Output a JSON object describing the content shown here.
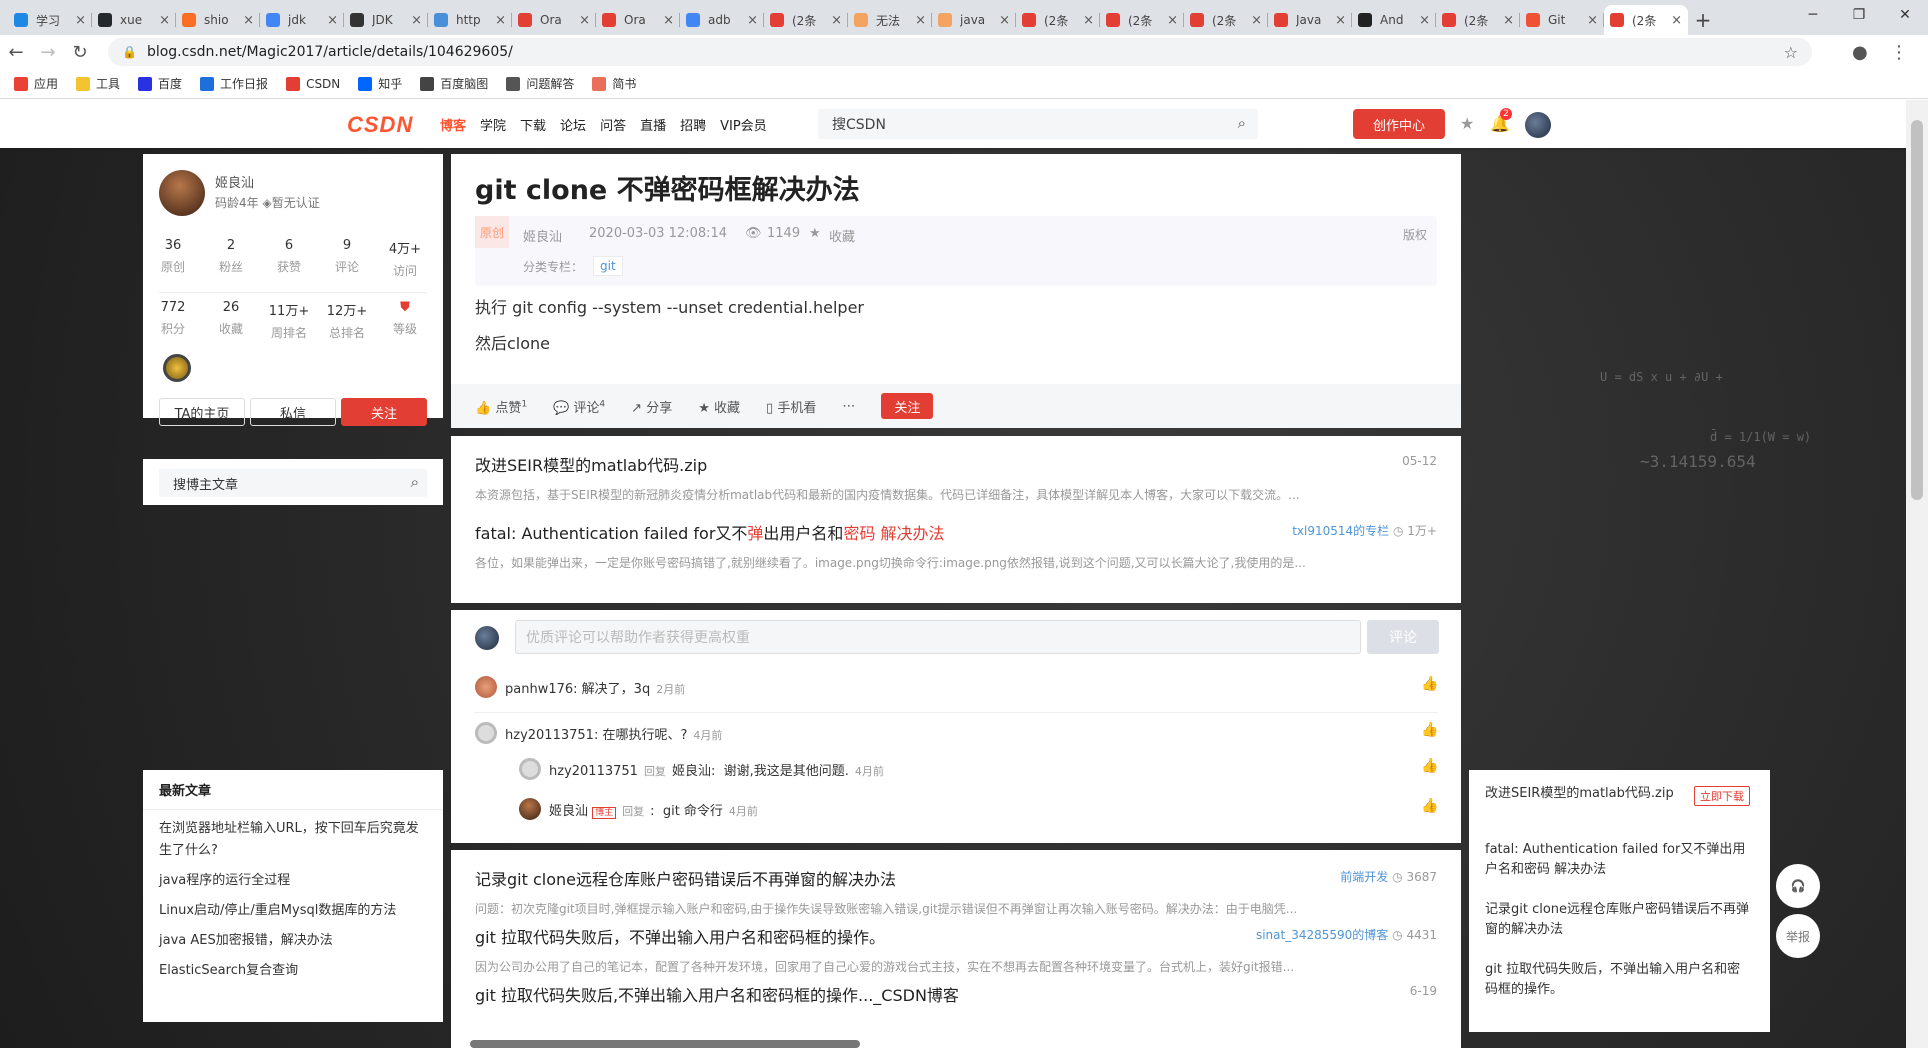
{
  "browser": {
    "tabs": [
      {
        "label": "学习",
        "color": "#1e88e5"
      },
      {
        "label": "xue",
        "color": "#24292e"
      },
      {
        "label": "shio",
        "color": "#fc6d26"
      },
      {
        "label": "jdk",
        "color": "#4285f4"
      },
      {
        "label": "JDK",
        "color": "#333"
      },
      {
        "label": "http",
        "color": "#4a90d9"
      },
      {
        "label": "Ora",
        "color": "#e33e33"
      },
      {
        "label": "Ora",
        "color": "#e33e33"
      },
      {
        "label": "adb",
        "color": "#4285f4"
      },
      {
        "label": "(2条",
        "color": "#e33e33"
      },
      {
        "label": "无法",
        "color": "#f4a460"
      },
      {
        "label": "java",
        "color": "#f4a460"
      },
      {
        "label": "(2条",
        "color": "#e33e33"
      },
      {
        "label": "(2条",
        "color": "#e33e33"
      },
      {
        "label": "(2条",
        "color": "#e33e33"
      },
      {
        "label": "Java",
        "color": "#e33e33"
      },
      {
        "label": "And",
        "color": "#222"
      },
      {
        "label": "(2条",
        "color": "#e33e33"
      },
      {
        "label": "Git",
        "color": "#f05033"
      },
      {
        "label": "(2条",
        "color": "#e33e33"
      }
    ],
    "url": "blog.csdn.net/Magic2017/article/details/104629605/",
    "bookmarks": [
      {
        "label": "应用",
        "color": "#ea4335"
      },
      {
        "label": "工具",
        "color": "#f4c430"
      },
      {
        "label": "百度",
        "color": "#2932e1"
      },
      {
        "label": "工作日报",
        "color": "#1e6fd9"
      },
      {
        "label": "CSDN",
        "color": "#e33e33"
      },
      {
        "label": "知乎",
        "color": "#0066ff"
      },
      {
        "label": "百度脑图",
        "color": "#444"
      },
      {
        "label": "问题解答",
        "color": "#555"
      },
      {
        "label": "简书",
        "color": "#ea6f5a"
      }
    ]
  },
  "nav": {
    "logo": "CSDN",
    "links": [
      "博客",
      "学院",
      "下载",
      "论坛",
      "问答",
      "直播",
      "招聘",
      "VIP会员"
    ],
    "search_placeholder": "搜CSDN",
    "create": "创作中心",
    "badge": "2"
  },
  "profile": {
    "name": "姬良汕",
    "age": "码龄4年",
    "cert": "暂无认证",
    "stats1": [
      {
        "n": "36",
        "l": "原创"
      },
      {
        "n": "2",
        "l": "粉丝"
      },
      {
        "n": "6",
        "l": "获赞"
      },
      {
        "n": "9",
        "l": "评论"
      },
      {
        "n": "4万+",
        "l": "访问"
      }
    ],
    "stats2": [
      {
        "n": "772",
        "l": "积分"
      },
      {
        "n": "26",
        "l": "收藏"
      },
      {
        "n": "11万+",
        "l": "周排名"
      },
      {
        "n": "12万+",
        "l": "总排名"
      },
      {
        "n": "",
        "l": "等级"
      }
    ],
    "btn_home": "TA的主页",
    "btn_msg": "私信",
    "btn_follow": "关注"
  },
  "blog_search": "搜博主文章",
  "latest": {
    "title": "最新文章",
    "items": [
      "在浏览器地址栏输入URL，按下回车后究竟发生了什么?",
      "java程序的运行全过程",
      "Linux启动/停止/重启Mysql数据库的方法",
      "java AES加密报错，解决办法",
      "ElasticSearch复合查询"
    ]
  },
  "article": {
    "title": "git clone 不弹密码框解决办法",
    "type": "原创",
    "author": "姬良汕",
    "date": "2020-03-03 12:08:14",
    "views": "1149",
    "fav": "收藏",
    "copyright": "版权",
    "column_label": "分类专栏：",
    "column": "git",
    "p1": "执行 git config --system --unset credential.helper",
    "p2": "然后clone",
    "actions": {
      "like": "点赞",
      "like_n": "1",
      "comment": "评论",
      "comment_n": "4",
      "share": "分享",
      "collect": "收藏",
      "mobile": "手机看",
      "follow": "关注"
    }
  },
  "recs": [
    {
      "title": "改进SEIR模型的matlab代码.zip",
      "desc": "本资源包括，基于SEIR模型的新冠肺炎疫情分析matlab代码和最新的国内疫情数据集。代码已详细备注，具体模型详解见本人博客，大家可以下载交流。...",
      "date": "05-12"
    },
    {
      "title_a": "fatal: Authentication failed for又不",
      "title_b": "弹",
      "title_c": "出用户名和",
      "title_d": "密码",
      "title_e": " 解决办法",
      "desc": "各位，如果能弹出来，一定是你账号密码搞错了,就别继续看了。image.png切换命令行:image.png依然报错,说到这个问题,又可以长篇大论了,我使用的是...",
      "source": "txl910514的专栏",
      "views": "1万+"
    }
  ],
  "comments": {
    "placeholder": "优质评论可以帮助作者获得更高权重",
    "submit": "评论",
    "list": [
      {
        "user": "panhw176",
        "text": "解决了，3q",
        "date": "2月前"
      },
      {
        "user": "hzy20113751",
        "text": "在哪执行呢、?",
        "date": "4月前"
      }
    ],
    "replies": [
      {
        "user": "hzy20113751",
        "rp": "回复",
        "to": "姬良汕",
        "text": "谢谢,我这是其他问题.",
        "date": "4月前"
      },
      {
        "user": "姬良汕",
        "tag": "博主",
        "rp": "回复",
        "text": "git 命令行",
        "date": "4月前"
      }
    ]
  },
  "more": [
    {
      "title": "记录git clone远程仓库账户密码错误后不再弹窗的解决办法",
      "desc": "问题：初次克隆git项目时,弹框提示输入账户和密码,由于操作失误导致账密输入错误,git提示错误但不再弹窗让再次输入账号密码。解决办法：由于电脑凭...",
      "source": "前端开发",
      "views": "3687"
    },
    {
      "title": "git 拉取代码失败后，不弹出输入用户名和密码框的操作。",
      "desc": "因为公司办公用了自己的笔记本，配置了各种开发环境，回家用了自己心爱的游戏台式主技，实在不想再去配置各种环境变量了。台式机上，装好git报错...",
      "source": "sinat_34285590的博客",
      "views": "4431"
    },
    {
      "title": "git 拉取代码失败后,不弹出输入用户名和密码框的操作..._CSDN博客",
      "date": "6-19"
    }
  ],
  "right_panel": {
    "dl_btn": "立即下载",
    "items": [
      "改进SEIR模型的matlab代码.zip",
      "fatal: Authentication failed for又不弹出用户名和密码 解决办法",
      "记录git clone远程仓库账户密码错误后不再弹窗的解决办法",
      "git 拉取代码失败后，不弹出输入用户名和密码框的操作。"
    ]
  },
  "float": {
    "report": "举报"
  },
  "deco": {
    "eq1": "U = dS x u + ∂U +",
    "eq2": "d̄ = 1/1(W = w)",
    "eq3": "~3.14159.654"
  }
}
